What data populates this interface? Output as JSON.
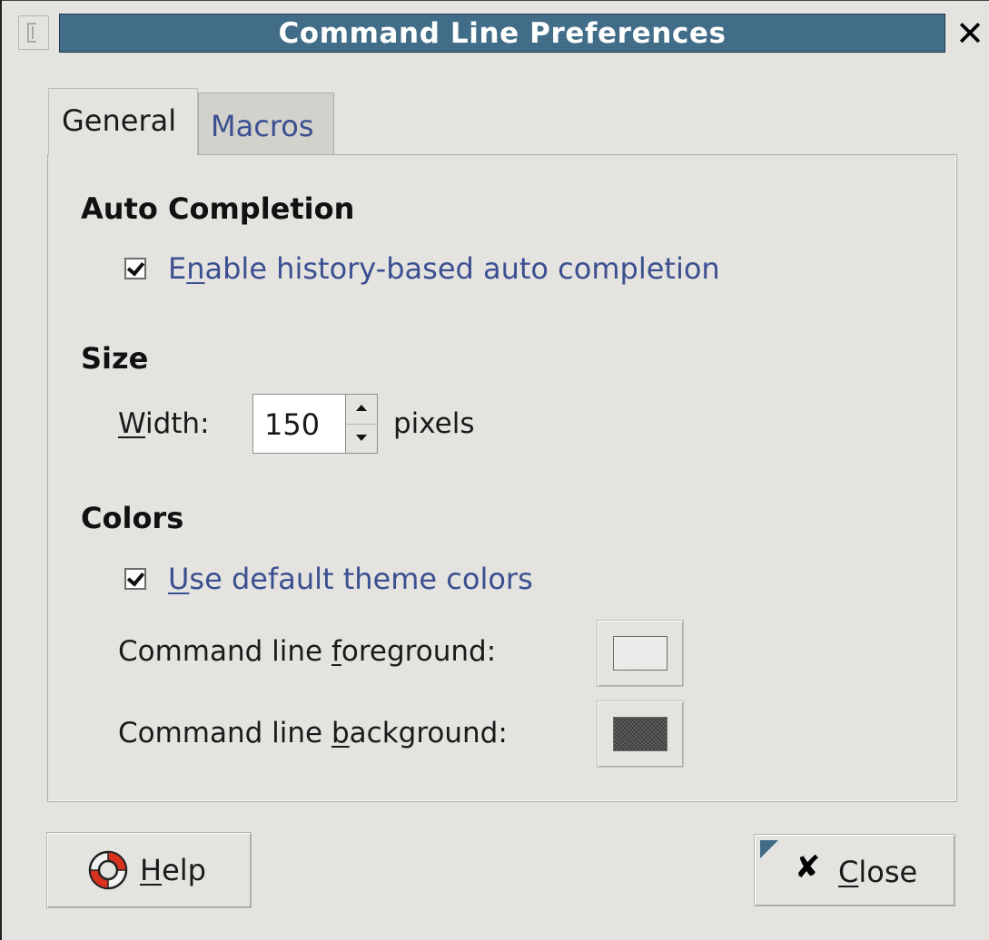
{
  "window": {
    "title": "Command Line Preferences",
    "close_glyph": "✕",
    "menu_icon": "window-menu-icon"
  },
  "tabs": [
    {
      "label": "General",
      "selected": true
    },
    {
      "label": "Macros",
      "selected": false
    }
  ],
  "auto_completion": {
    "heading": "Auto Completion",
    "checkbox": {
      "label_pre": "E",
      "label_mnemonic": "n",
      "label_post": "able history-based auto completion",
      "checked": true
    }
  },
  "size": {
    "heading": "Size",
    "width_label_mnemonic": "W",
    "width_label_post": "idth:",
    "width_value": "150",
    "unit": "pixels"
  },
  "colors": {
    "heading": "Colors",
    "checkbox": {
      "label_mnemonic": "U",
      "label_post": "se default theme colors",
      "checked": true
    },
    "foreground": {
      "label_pre": "Command line ",
      "label_mnemonic": "f",
      "label_post": "oreground:",
      "swatch_color": "#eeeeec"
    },
    "background": {
      "label_pre": "Command line ",
      "label_mnemonic": "b",
      "label_post": "ackground:",
      "swatch_color": "#3a3a3a"
    }
  },
  "buttons": {
    "help": {
      "mnemonic": "H",
      "post": "elp",
      "icon": "lifebuoy-help-icon"
    },
    "close": {
      "glyph": "✘",
      "mnemonic": "C",
      "post": "lose",
      "icon": "close-x-icon"
    }
  },
  "theme": {
    "titlebar_color": "#3f6b87",
    "link_text_color": "#3b4f91",
    "window_bg": "#e4e3df"
  }
}
